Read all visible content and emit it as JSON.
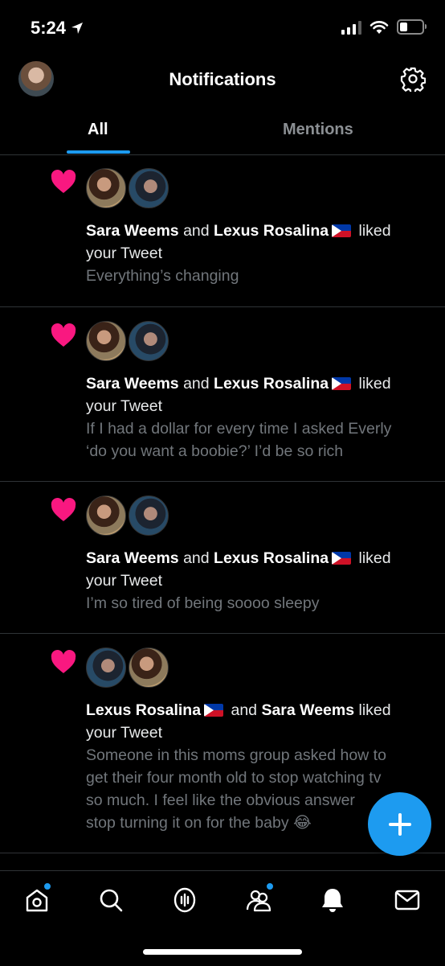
{
  "status_bar": {
    "time": "5:24"
  },
  "header": {
    "title": "Notifications"
  },
  "tabs": [
    {
      "label": "All",
      "active": true
    },
    {
      "label": "Mentions",
      "active": false
    }
  ],
  "notifications": [
    {
      "users": [
        "Sara Weems",
        "Lexus Rosalina"
      ],
      "connector": "and",
      "action": "liked",
      "object": "your Tweet",
      "tweet_lines": [
        "Everything’s changing"
      ]
    },
    {
      "users": [
        "Sara Weems",
        "Lexus Rosalina"
      ],
      "connector": "and",
      "action": "liked",
      "object": "your Tweet",
      "tweet_lines": [
        "If I had a dollar for every time I asked Everly",
        "‘do you want a boobie?’ I’d be so rich"
      ]
    },
    {
      "users": [
        "Sara Weems",
        "Lexus Rosalina"
      ],
      "connector": "and",
      "action": "liked",
      "object": "your Tweet",
      "tweet_lines": [
        "I’m so tired of being soooo sleepy"
      ]
    },
    {
      "users": [
        "Lexus Rosalina",
        "Sara Weems"
      ],
      "connector": "and",
      "action": "liked",
      "object": "your Tweet",
      "tweet_lines": [
        "Someone in this moms group asked how to",
        "get their four month old to stop watching tv",
        "so much. I feel like the obvious answer",
        "stop turning it on for the baby 😂"
      ]
    }
  ],
  "colors": {
    "accent": "#1d9bf0",
    "heart": "#f91880",
    "background": "#000000"
  },
  "bottom_nav": [
    "home-icon",
    "search-icon",
    "spaces-icon",
    "communities-icon",
    "notifications-icon",
    "messages-icon"
  ]
}
